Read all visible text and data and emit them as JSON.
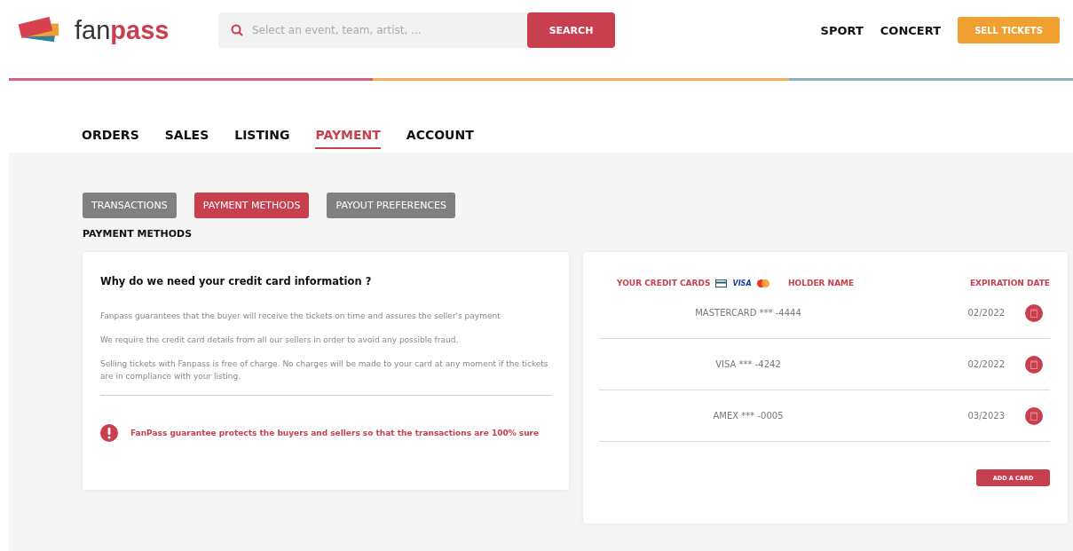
{
  "logo": {
    "first": "fan",
    "second": "pass"
  },
  "search": {
    "placeholder": "Select an event, team, artist, ...",
    "button": "SEARCH"
  },
  "top_nav": [
    "SPORT",
    "CONCERT"
  ],
  "sell_button": "SELL TICKETS",
  "tabs": [
    {
      "label": "ORDERS",
      "selected": false
    },
    {
      "label": "SALES",
      "selected": false
    },
    {
      "label": "LISTING",
      "selected": false
    },
    {
      "label": "PAYMENT",
      "selected": true
    },
    {
      "label": "ACCOUNT",
      "selected": false
    }
  ],
  "sub_tabs": [
    {
      "label": "TRANSACTIONS",
      "selected": false
    },
    {
      "label": "PAYMENT METHODS",
      "selected": true
    },
    {
      "label": "PAYOUT PREFERENCES",
      "selected": false
    }
  ],
  "section_title": "PAYMENT METHODS",
  "info": {
    "title": "Why do we need your credit card information ?",
    "paragraphs": [
      "Fanpass guarantees that the buyer will receive the tickets on time and assures the seller's payment",
      "We require the credit card details from all our sellers in order to avoid any possible fraud.",
      "Selling tickets with Fanpass is free of charge. No charges will be made to your card at any moment if the tickets are in compliance with your listing."
    ],
    "notice": "FanPass guarantee protects the buyers and sellers so that the transactions are 100% sure"
  },
  "cards": {
    "columns": [
      "YOUR CREDIT CARDS",
      "HOLDER NAME",
      "EXPIRATION DATE"
    ],
    "visa_label": "VISA",
    "rows": [
      {
        "card": "MASTERCARD *** -4444",
        "expiration": "02/2022"
      },
      {
        "card": "VISA *** -4242",
        "expiration": "02/2022"
      },
      {
        "card": "AMEX *** -0005",
        "expiration": "03/2023"
      }
    ],
    "add_button": "ADD A CARD"
  }
}
